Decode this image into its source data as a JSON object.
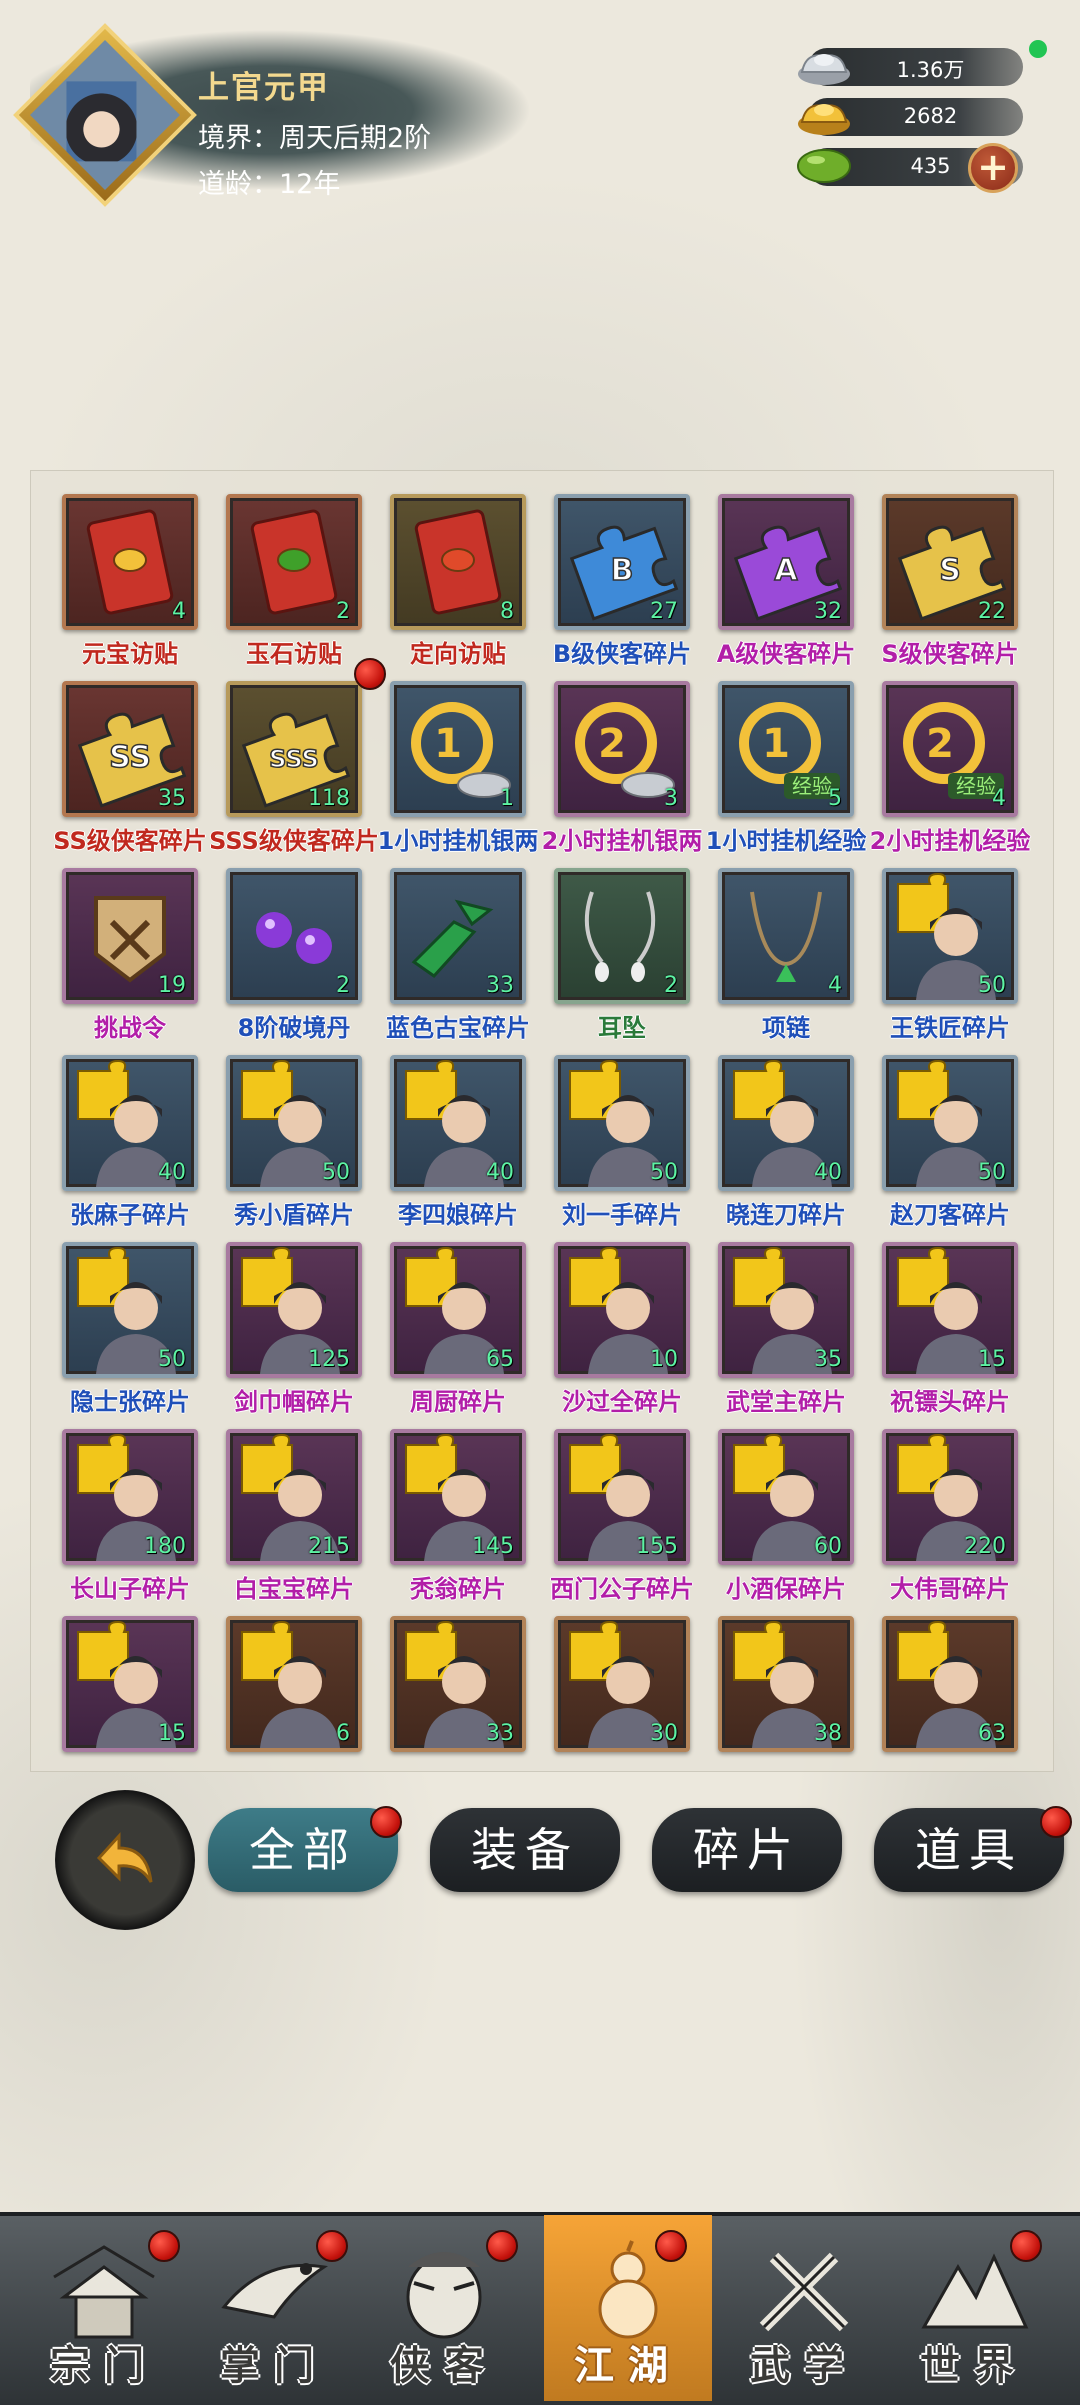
{
  "player": {
    "name": "上官元甲",
    "realm": "境界：周天后期2阶",
    "age": "道龄：12年"
  },
  "resources": {
    "silver": "1.36万",
    "gold": "2682",
    "jade": "435",
    "plus": "+"
  },
  "inventory": {
    "items": [
      {
        "label": "元宝访贴",
        "qty": "4",
        "color": "red",
        "labelColor": "lbl-red",
        "icon": "gold-invite-card-icon"
      },
      {
        "label": "玉石访贴",
        "qty": "2",
        "color": "red",
        "labelColor": "lbl-red",
        "icon": "jade-invite-card-icon"
      },
      {
        "label": "定向访贴",
        "qty": "8",
        "color": "olive",
        "labelColor": "lbl-red",
        "icon": "directed-invite-card-icon"
      },
      {
        "label": "B级侠客碎片",
        "qty": "27",
        "color": "blue",
        "labelColor": "lbl-blue",
        "icon": "b-puzzle-icon"
      },
      {
        "label": "A级侠客碎片",
        "qty": "32",
        "color": "purple",
        "labelColor": "lbl-purple",
        "icon": "a-puzzle-icon"
      },
      {
        "label": "S级侠客碎片",
        "qty": "22",
        "color": "brown",
        "labelColor": "lbl-purple",
        "icon": "s-puzzle-icon"
      },
      {
        "label": "SS级侠客碎片",
        "qty": "35",
        "color": "red",
        "labelColor": "lbl-red",
        "icon": "ss-puzzle-icon"
      },
      {
        "label": "SSS级侠客碎片",
        "qty": "118",
        "color": "olive",
        "labelColor": "lbl-red",
        "icon": "sss-puzzle-icon"
      },
      {
        "label": "1小时挂机银两",
        "qty": "1",
        "color": "blue",
        "labelColor": "lbl-blue",
        "icon": "1h-silver-icon"
      },
      {
        "label": "2小时挂机银两",
        "qty": "3",
        "color": "purple",
        "labelColor": "lbl-purple",
        "icon": "2h-silver-icon"
      },
      {
        "label": "1小时挂机经验",
        "qty": "5",
        "color": "blue",
        "labelColor": "lbl-blue",
        "icon": "1h-exp-icon"
      },
      {
        "label": "2小时挂机经验",
        "qty": "4",
        "color": "purple",
        "labelColor": "lbl-purple",
        "icon": "2h-exp-icon"
      },
      {
        "label": "挑战令",
        "qty": "19",
        "color": "purple",
        "labelColor": "lbl-purple",
        "icon": "challenge-token-icon"
      },
      {
        "label": "8阶破境丹",
        "qty": "2",
        "color": "blue",
        "labelColor": "lbl-blue",
        "icon": "pill-icon"
      },
      {
        "label": "蓝色古宝碎片",
        "qty": "33",
        "color": "blue",
        "labelColor": "lbl-blue",
        "icon": "jade-shard-icon"
      },
      {
        "label": "耳坠",
        "qty": "2",
        "color": "green",
        "labelColor": "lbl-green",
        "icon": "earring-icon"
      },
      {
        "label": "项链",
        "qty": "4",
        "color": "blue",
        "labelColor": "lbl-blue",
        "icon": "necklace-icon"
      },
      {
        "label": "王铁匠碎片",
        "qty": "50",
        "color": "blue",
        "labelColor": "lbl-blue",
        "icon": "hero-portrait-icon"
      },
      {
        "label": "张麻子碎片",
        "qty": "40",
        "color": "blue",
        "labelColor": "lbl-blue",
        "icon": "hero-portrait-icon"
      },
      {
        "label": "秀小盾碎片",
        "qty": "50",
        "color": "blue",
        "labelColor": "lbl-blue",
        "icon": "hero-portrait-icon"
      },
      {
        "label": "李四娘碎片",
        "qty": "40",
        "color": "blue",
        "labelColor": "lbl-blue",
        "icon": "hero-portrait-icon"
      },
      {
        "label": "刘一手碎片",
        "qty": "50",
        "color": "blue",
        "labelColor": "lbl-blue",
        "icon": "hero-portrait-icon"
      },
      {
        "label": "晓连刀碎片",
        "qty": "40",
        "color": "blue",
        "labelColor": "lbl-blue",
        "icon": "hero-portrait-icon"
      },
      {
        "label": "赵刀客碎片",
        "qty": "50",
        "color": "blue",
        "labelColor": "lbl-blue",
        "icon": "hero-portrait-icon"
      },
      {
        "label": "隐士张碎片",
        "qty": "50",
        "color": "blue",
        "labelColor": "lbl-blue",
        "icon": "hero-portrait-icon"
      },
      {
        "label": "剑巾帼碎片",
        "qty": "125",
        "color": "purple",
        "labelColor": "lbl-purple",
        "icon": "hero-portrait-icon"
      },
      {
        "label": "周厨碎片",
        "qty": "65",
        "color": "purple",
        "labelColor": "lbl-purple",
        "icon": "hero-portrait-icon"
      },
      {
        "label": "沙过全碎片",
        "qty": "10",
        "color": "purple",
        "labelColor": "lbl-purple",
        "icon": "hero-portrait-icon"
      },
      {
        "label": "武堂主碎片",
        "qty": "35",
        "color": "purple",
        "labelColor": "lbl-purple",
        "icon": "hero-portrait-icon"
      },
      {
        "label": "祝镖头碎片",
        "qty": "15",
        "color": "purple",
        "labelColor": "lbl-purple",
        "icon": "hero-portrait-icon"
      },
      {
        "label": "长山子碎片",
        "qty": "180",
        "color": "purple",
        "labelColor": "lbl-purple",
        "icon": "hero-portrait-icon"
      },
      {
        "label": "白宝宝碎片",
        "qty": "215",
        "color": "purple",
        "labelColor": "lbl-purple",
        "icon": "hero-portrait-icon"
      },
      {
        "label": "秃翁碎片",
        "qty": "145",
        "color": "purple",
        "labelColor": "lbl-purple",
        "icon": "hero-portrait-icon"
      },
      {
        "label": "西门公子碎片",
        "qty": "155",
        "color": "purple",
        "labelColor": "lbl-purple",
        "icon": "hero-portrait-icon"
      },
      {
        "label": "小酒保碎片",
        "qty": "60",
        "color": "purple",
        "labelColor": "lbl-purple",
        "icon": "hero-portrait-icon"
      },
      {
        "label": "大伟哥碎片",
        "qty": "220",
        "color": "purple",
        "labelColor": "lbl-purple",
        "icon": "hero-portrait-icon"
      },
      {
        "label": "",
        "qty": "15",
        "color": "purple",
        "labelColor": "lbl-purple",
        "icon": "hero-portrait-icon"
      },
      {
        "label": "",
        "qty": "6",
        "color": "brown",
        "labelColor": "lbl-dark",
        "icon": "hero-portrait-icon"
      },
      {
        "label": "",
        "qty": "33",
        "color": "brown",
        "labelColor": "lbl-dark",
        "icon": "hero-portrait-icon"
      },
      {
        "label": "",
        "qty": "30",
        "color": "brown",
        "labelColor": "lbl-dark",
        "icon": "hero-portrait-icon"
      },
      {
        "label": "",
        "qty": "38",
        "color": "brown",
        "labelColor": "lbl-dark",
        "icon": "hero-portrait-icon"
      },
      {
        "label": "",
        "qty": "63",
        "color": "brown",
        "labelColor": "lbl-dark",
        "icon": "hero-portrait-icon"
      }
    ]
  },
  "filters": {
    "all": "全部",
    "equipment": "装备",
    "fragments": "碎片",
    "items": "道具"
  },
  "nav": {
    "sect": "宗门",
    "master": "掌门",
    "heroes": "侠客",
    "jianghu": "江湖",
    "martial": "武学",
    "world": "世界"
  }
}
